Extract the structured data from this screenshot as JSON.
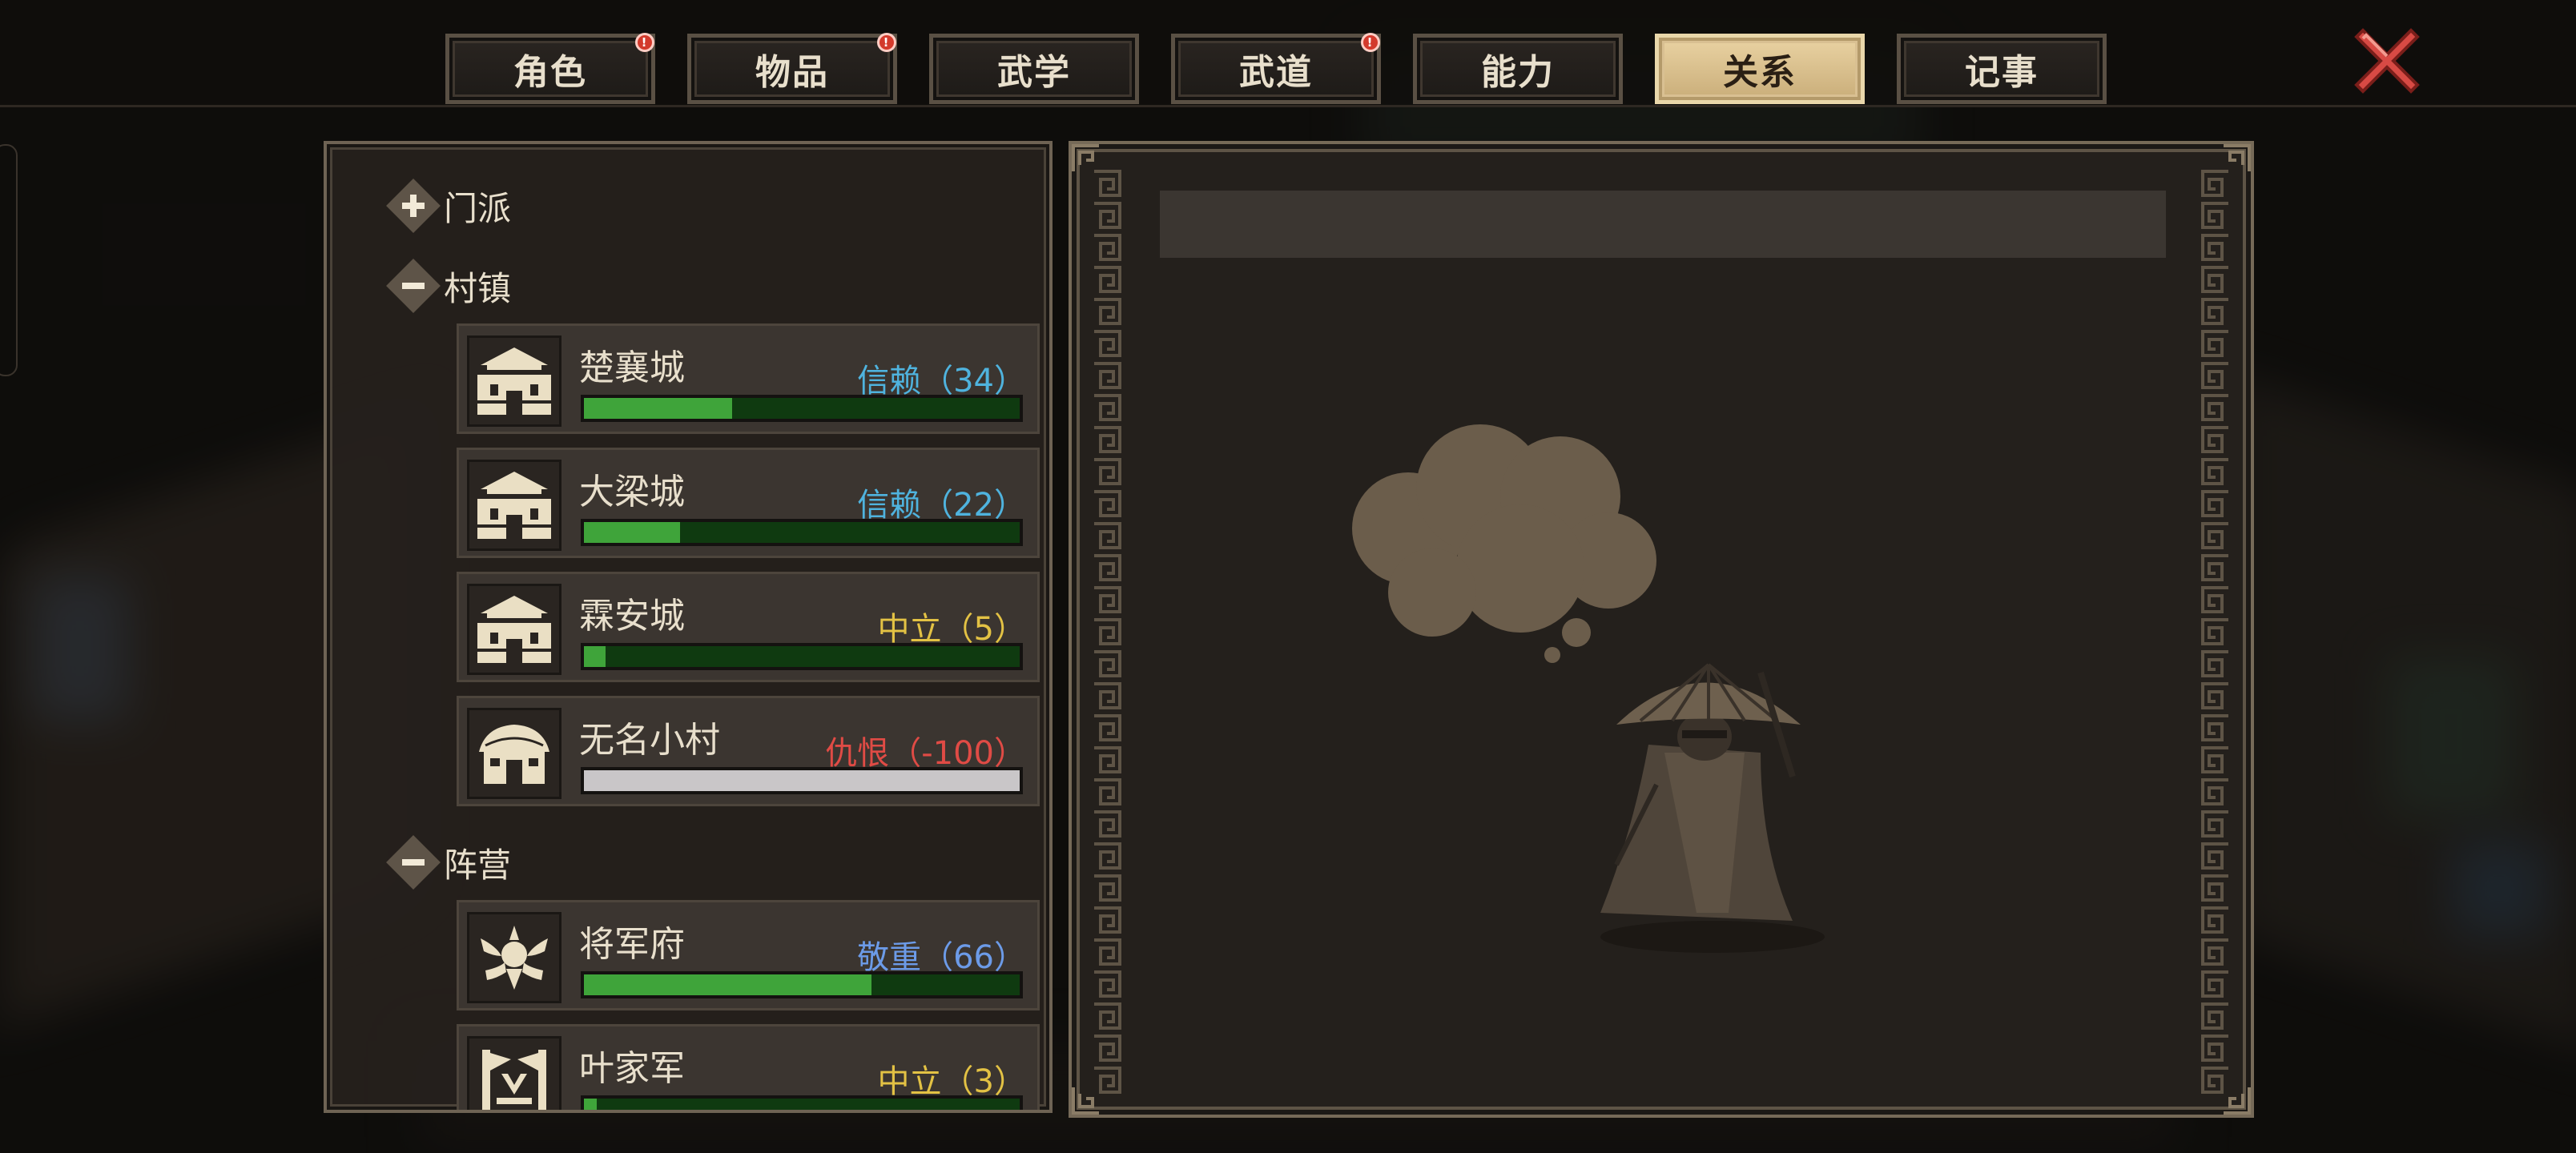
{
  "tabs": [
    {
      "label": "角色",
      "badge": "!",
      "active": false
    },
    {
      "label": "物品",
      "badge": "!",
      "active": false
    },
    {
      "label": "武学",
      "badge": "",
      "active": false
    },
    {
      "label": "武道",
      "badge": "!",
      "active": false
    },
    {
      "label": "能力",
      "badge": "",
      "active": false
    },
    {
      "label": "关系",
      "badge": "",
      "active": true
    },
    {
      "label": "记事",
      "badge": "",
      "active": false
    }
  ],
  "groups": {
    "sect": {
      "label": "门派",
      "state": "collapsed"
    },
    "towns": {
      "label": "村镇",
      "state": "expanded"
    },
    "factions": {
      "label": "阵营",
      "state": "expanded"
    }
  },
  "entries": [
    {
      "name": "楚襄城",
      "status": "信赖（34）",
      "status_color": "#4fb3de",
      "progress": 0.34,
      "icon": "city-gate-icon"
    },
    {
      "name": "大梁城",
      "status": "信赖（22）",
      "status_color": "#4fb3de",
      "progress": 0.22,
      "icon": "city-gate-icon"
    },
    {
      "name": "霖安城",
      "status": "中立（5）",
      "status_color": "#e3c244",
      "progress": 0.05,
      "icon": "city-gate-icon"
    },
    {
      "name": "无名小村",
      "status": "仇恨（-100）",
      "status_color": "#e04b45",
      "progress": 0.0,
      "icon": "village-hut-icon"
    },
    {
      "name": "将军府",
      "status": "敬重（66）",
      "status_color": "#6c9be8",
      "progress": 0.66,
      "icon": "general-crest-icon"
    },
    {
      "name": "叶家军",
      "status": "中立（3）",
      "status_color": "#e3c244",
      "progress": 0.03,
      "icon": "army-banner-icon"
    }
  ],
  "colors": {
    "bar_fill": "#3fa43a",
    "bar_track": "#0f3a10",
    "active_tab": "#e0c795",
    "close": "#d84a44"
  }
}
